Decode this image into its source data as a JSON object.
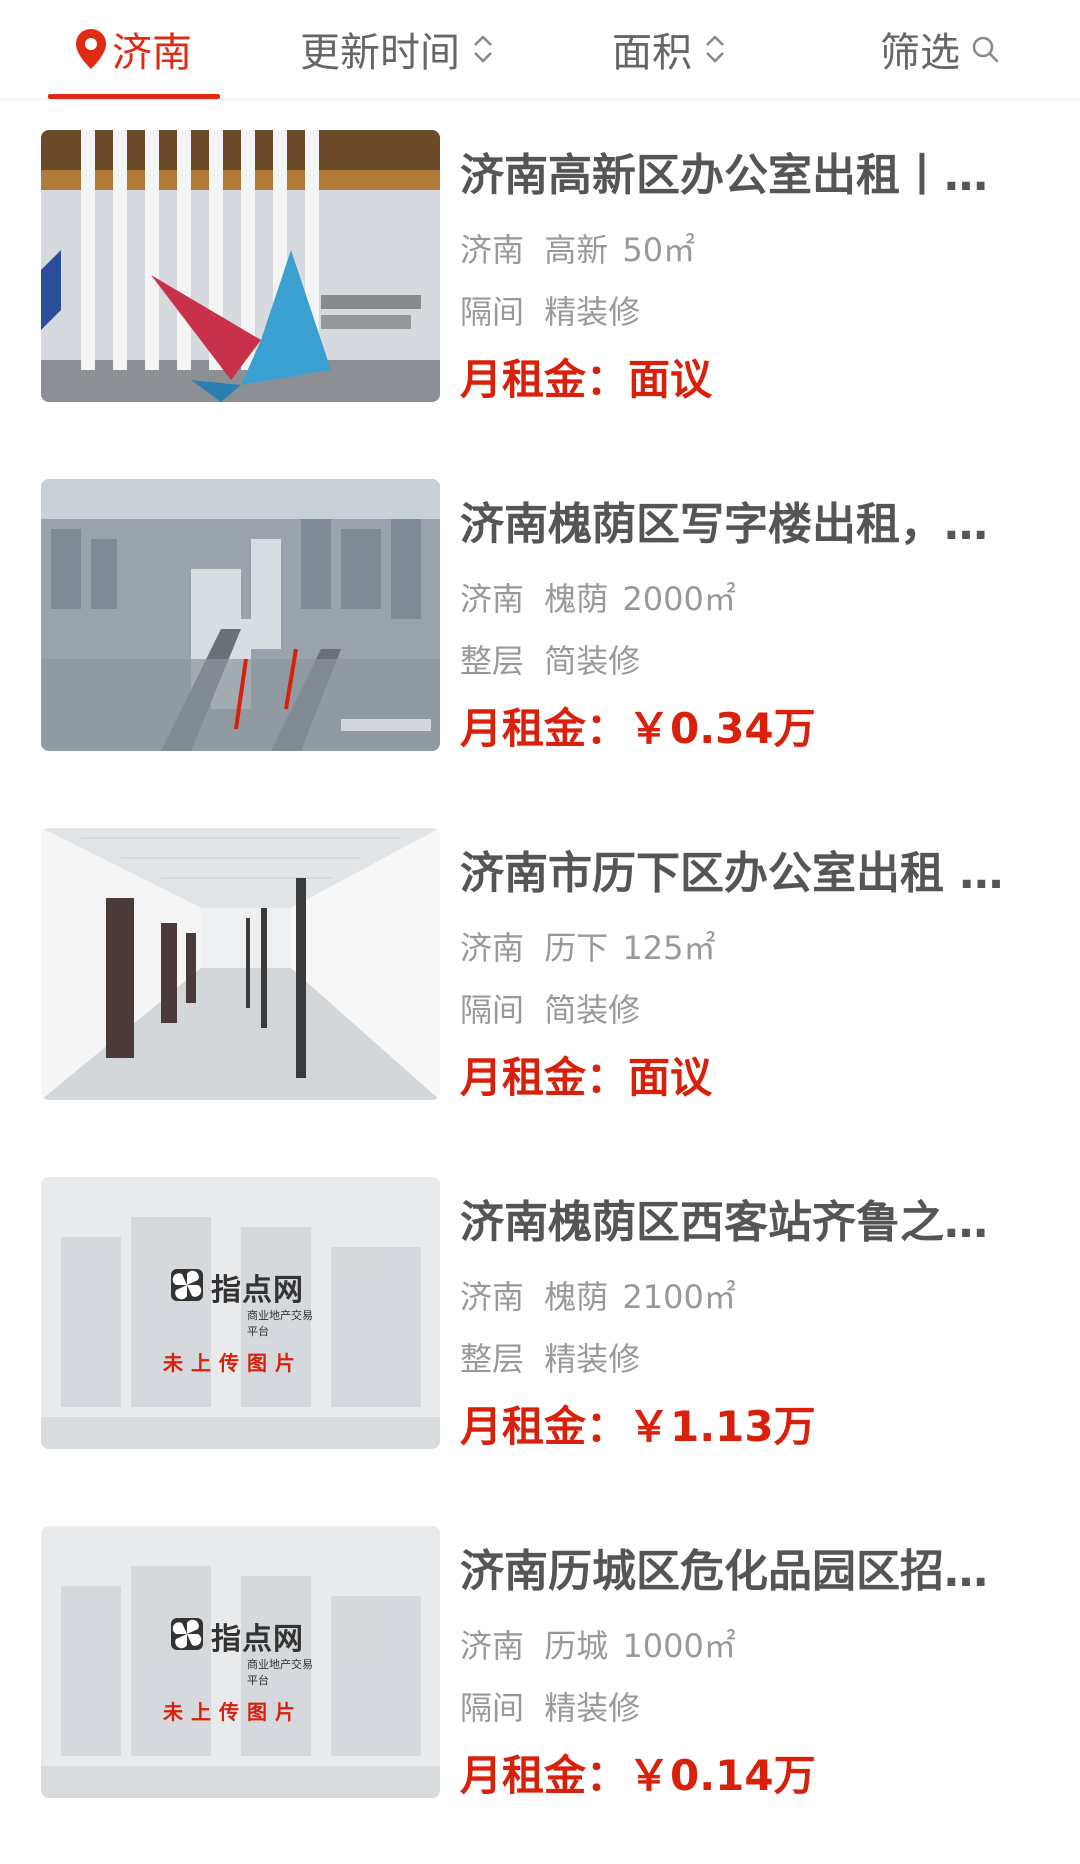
{
  "filter_bar": {
    "city": "济南",
    "updated": "更新时间",
    "area": "面积",
    "screen": "筛选"
  },
  "colors": {
    "accent": "#e02a12",
    "price": "#d8200a",
    "title": "#555555",
    "meta": "#999999"
  },
  "listings": [
    {
      "title": "济南高新区办公室出租丨…",
      "city": "济南",
      "district": "高新",
      "size": "50㎡",
      "layout": "隔间",
      "decoration": "精装修",
      "rent": "月租金：面议",
      "image": "office-lobby-photo"
    },
    {
      "title": "济南槐荫区写字楼出租，…",
      "city": "济南",
      "district": "槐荫",
      "size": "2000㎡",
      "layout": "整层",
      "decoration": "简装修",
      "rent": "月租金：￥0.34万",
      "image": "aerial-city-photo"
    },
    {
      "title": "济南市历下区办公室出租 …",
      "city": "济南",
      "district": "历下",
      "size": "125㎡",
      "layout": "隔间",
      "decoration": "简装修",
      "rent": "月租金：面议",
      "image": "corridor-interior-photo"
    },
    {
      "title": "济南槐荫区西客站齐鲁之…",
      "city": "济南",
      "district": "槐荫",
      "size": "2100㎡",
      "layout": "整层",
      "decoration": "精装修",
      "rent": "月租金：￥1.13万",
      "image": "placeholder-no-image",
      "placeholder": {
        "brand": "指点网",
        "tagline": "商业地产交易平台",
        "note": "未上传图片"
      }
    },
    {
      "title": "济南历城区危化品园区招…",
      "city": "济南",
      "district": "历城",
      "size": "1000㎡",
      "layout": "隔间",
      "decoration": "精装修",
      "rent": "月租金：￥0.14万",
      "image": "placeholder-no-image",
      "placeholder": {
        "brand": "指点网",
        "tagline": "商业地产交易平台",
        "note": "未上传图片"
      }
    }
  ]
}
